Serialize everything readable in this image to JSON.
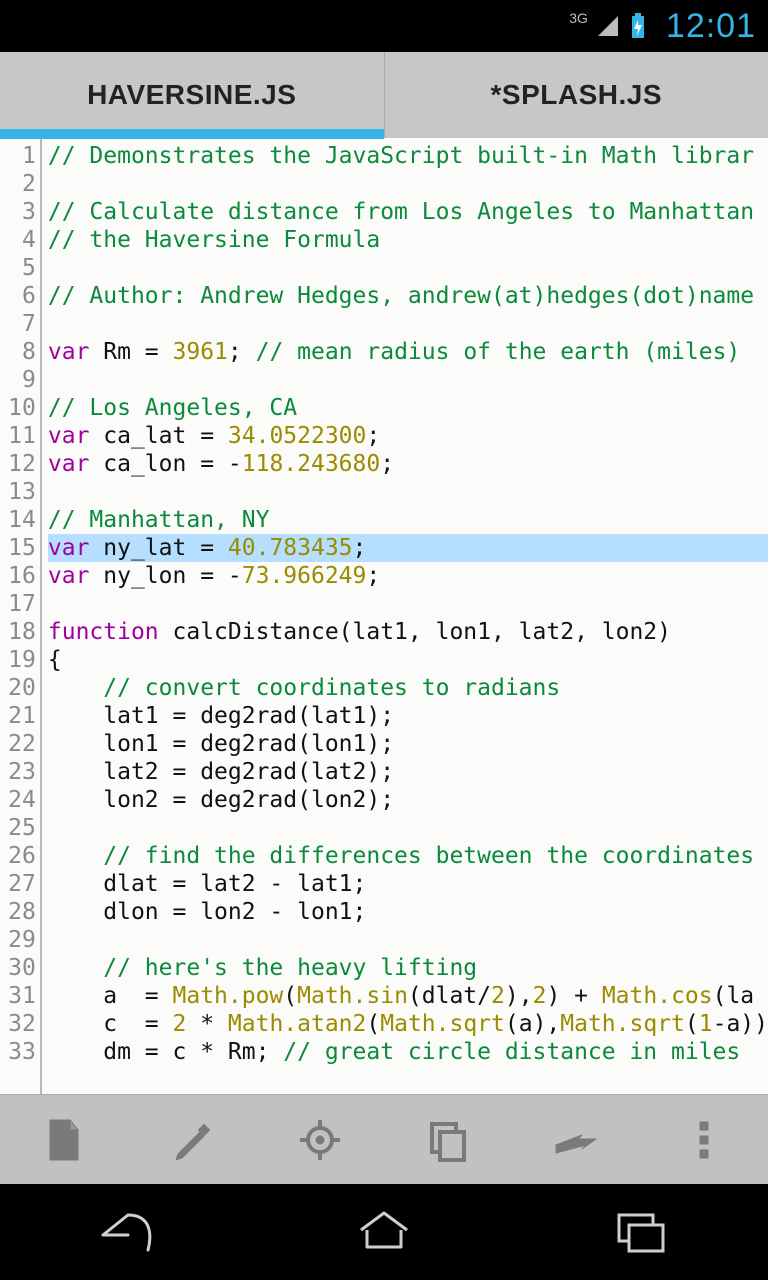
{
  "statusbar": {
    "network_label": "3G",
    "time": "12:01"
  },
  "tabs": [
    {
      "label": "HAVERSINE.JS",
      "active": true
    },
    {
      "label": "*SPLASH.JS",
      "active": false
    }
  ],
  "highlighted_line_index": 14,
  "code_lines": [
    {
      "n": 1,
      "tokens": [
        {
          "c": "tok-comment",
          "t": "// Demonstrates the JavaScript built-in Math librar"
        }
      ]
    },
    {
      "n": 2,
      "tokens": []
    },
    {
      "n": 3,
      "tokens": [
        {
          "c": "tok-comment",
          "t": "// Calculate distance from Los Angeles to Manhattan"
        }
      ]
    },
    {
      "n": 4,
      "tokens": [
        {
          "c": "tok-comment",
          "t": "// the Haversine Formula"
        }
      ]
    },
    {
      "n": 5,
      "tokens": []
    },
    {
      "n": 6,
      "tokens": [
        {
          "c": "tok-comment",
          "t": "// Author: Andrew Hedges, andrew(at)hedges(dot)name"
        }
      ]
    },
    {
      "n": 7,
      "tokens": []
    },
    {
      "n": 8,
      "tokens": [
        {
          "c": "tok-keyword",
          "t": "var"
        },
        {
          "c": "",
          "t": " Rm = "
        },
        {
          "c": "tok-number",
          "t": "3961"
        },
        {
          "c": "",
          "t": "; "
        },
        {
          "c": "tok-comment",
          "t": "// mean radius of the earth (miles)"
        }
      ]
    },
    {
      "n": 9,
      "tokens": []
    },
    {
      "n": 10,
      "tokens": [
        {
          "c": "tok-comment",
          "t": "// Los Angeles, CA"
        }
      ]
    },
    {
      "n": 11,
      "tokens": [
        {
          "c": "tok-keyword",
          "t": "var"
        },
        {
          "c": "",
          "t": " ca_lat = "
        },
        {
          "c": "tok-number",
          "t": "34.0522300"
        },
        {
          "c": "",
          "t": ";"
        }
      ]
    },
    {
      "n": 12,
      "tokens": [
        {
          "c": "tok-keyword",
          "t": "var"
        },
        {
          "c": "",
          "t": " ca_lon = -"
        },
        {
          "c": "tok-number",
          "t": "118.243680"
        },
        {
          "c": "",
          "t": ";"
        }
      ]
    },
    {
      "n": 13,
      "tokens": []
    },
    {
      "n": 14,
      "tokens": [
        {
          "c": "tok-comment",
          "t": "// Manhattan, NY"
        }
      ]
    },
    {
      "n": 15,
      "tokens": [
        {
          "c": "tok-keyword",
          "t": "var"
        },
        {
          "c": "",
          "t": " ny_lat = "
        },
        {
          "c": "tok-number",
          "t": "40.783435"
        },
        {
          "c": "",
          "t": ";"
        }
      ]
    },
    {
      "n": 16,
      "tokens": [
        {
          "c": "tok-keyword",
          "t": "var"
        },
        {
          "c": "",
          "t": " ny_lon = -"
        },
        {
          "c": "tok-number",
          "t": "73.966249"
        },
        {
          "c": "",
          "t": ";"
        }
      ]
    },
    {
      "n": 17,
      "tokens": []
    },
    {
      "n": 18,
      "tokens": [
        {
          "c": "tok-keyword",
          "t": "function"
        },
        {
          "c": "",
          "t": " calcDistance(lat1, lon1, lat2, lon2)"
        }
      ]
    },
    {
      "n": 19,
      "tokens": [
        {
          "c": "",
          "t": "{"
        }
      ]
    },
    {
      "n": 20,
      "tokens": [
        {
          "c": "",
          "t": "    "
        },
        {
          "c": "tok-comment",
          "t": "// convert coordinates to radians"
        }
      ]
    },
    {
      "n": 21,
      "tokens": [
        {
          "c": "",
          "t": "    lat1 = deg2rad(lat1);"
        }
      ]
    },
    {
      "n": 22,
      "tokens": [
        {
          "c": "",
          "t": "    lon1 = deg2rad(lon1);"
        }
      ]
    },
    {
      "n": 23,
      "tokens": [
        {
          "c": "",
          "t": "    lat2 = deg2rad(lat2);"
        }
      ]
    },
    {
      "n": 24,
      "tokens": [
        {
          "c": "",
          "t": "    lon2 = deg2rad(lon2);"
        }
      ]
    },
    {
      "n": 25,
      "tokens": []
    },
    {
      "n": 26,
      "tokens": [
        {
          "c": "",
          "t": "    "
        },
        {
          "c": "tok-comment",
          "t": "// find the differences between the coordinates"
        }
      ]
    },
    {
      "n": 27,
      "tokens": [
        {
          "c": "",
          "t": "    dlat = lat2 - lat1;"
        }
      ]
    },
    {
      "n": 28,
      "tokens": [
        {
          "c": "",
          "t": "    dlon = lon2 - lon1;"
        }
      ]
    },
    {
      "n": 29,
      "tokens": []
    },
    {
      "n": 30,
      "tokens": [
        {
          "c": "",
          "t": "    "
        },
        {
          "c": "tok-comment",
          "t": "// here's the heavy lifting"
        }
      ]
    },
    {
      "n": 31,
      "tokens": [
        {
          "c": "",
          "t": "    a  = "
        },
        {
          "c": "tok-ident-builtin",
          "t": "Math.pow"
        },
        {
          "c": "",
          "t": "("
        },
        {
          "c": "tok-ident-builtin",
          "t": "Math.sin"
        },
        {
          "c": "",
          "t": "(dlat/"
        },
        {
          "c": "tok-number",
          "t": "2"
        },
        {
          "c": "",
          "t": "),"
        },
        {
          "c": "tok-number",
          "t": "2"
        },
        {
          "c": "",
          "t": ") + "
        },
        {
          "c": "tok-ident-builtin",
          "t": "Math.cos"
        },
        {
          "c": "",
          "t": "(la"
        }
      ]
    },
    {
      "n": 32,
      "tokens": [
        {
          "c": "",
          "t": "    c  = "
        },
        {
          "c": "tok-number",
          "t": "2"
        },
        {
          "c": "",
          "t": " * "
        },
        {
          "c": "tok-ident-builtin",
          "t": "Math.atan2"
        },
        {
          "c": "",
          "t": "("
        },
        {
          "c": "tok-ident-builtin",
          "t": "Math.sqrt"
        },
        {
          "c": "",
          "t": "(a),"
        },
        {
          "c": "tok-ident-builtin",
          "t": "Math.sqrt"
        },
        {
          "c": "",
          "t": "("
        },
        {
          "c": "tok-number",
          "t": "1"
        },
        {
          "c": "",
          "t": "-a))"
        }
      ]
    },
    {
      "n": 33,
      "tokens": [
        {
          "c": "",
          "t": "    dm = c * Rm; "
        },
        {
          "c": "tok-comment",
          "t": "// great circle distance in miles"
        }
      ]
    }
  ],
  "toolbar_buttons": [
    {
      "name": "new-file-icon"
    },
    {
      "name": "edit-icon"
    },
    {
      "name": "target-icon"
    },
    {
      "name": "copy-icon"
    },
    {
      "name": "run-icon"
    },
    {
      "name": "overflow-icon"
    }
  ]
}
